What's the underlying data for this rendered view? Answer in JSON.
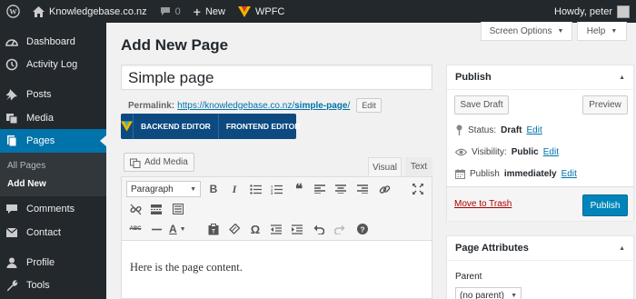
{
  "adminbar": {
    "site_name": "Knowledgebase.co.nz",
    "comments_count": "0",
    "new_label": "New",
    "plugin_label": "WPFC",
    "greeting": "Howdy, peter"
  },
  "sidebar": {
    "items": [
      {
        "label": "Dashboard",
        "icon": "dashboard-icon"
      },
      {
        "label": "Activity Log",
        "icon": "activity-log-icon"
      },
      {
        "label": "Posts",
        "icon": "pin-icon"
      },
      {
        "label": "Media",
        "icon": "media-icon"
      },
      {
        "label": "Pages",
        "icon": "pages-icon"
      },
      {
        "label": "Comments",
        "icon": "comments-icon"
      },
      {
        "label": "Contact",
        "icon": "envelope-icon"
      },
      {
        "label": "Profile",
        "icon": "user-icon"
      },
      {
        "label": "Tools",
        "icon": "wrench-icon"
      }
    ],
    "submenu": [
      {
        "label": "All Pages"
      },
      {
        "label": "Add New"
      }
    ]
  },
  "header": {
    "screen_options": "Screen Options",
    "help": "Help",
    "page_title": "Add New Page"
  },
  "editor": {
    "title_value": "Simple page",
    "permalink_label": "Permalink:",
    "permalink_base": "https://knowledgebase.co.nz/",
    "permalink_slug": "simple-page",
    "permalink_trailing": "/",
    "edit_label": "Edit",
    "builder": {
      "backend": "BACKEND EDITOR",
      "frontend": "FRONTEND EDITOR"
    },
    "add_media": "Add Media",
    "tab_visual": "Visual",
    "tab_text": "Text",
    "format_value": "Paragraph",
    "content": "Here is the page content."
  },
  "publish": {
    "title": "Publish",
    "save_draft": "Save Draft",
    "preview": "Preview",
    "status_label": "Status:",
    "status_value": "Draft",
    "visibility_label": "Visibility:",
    "visibility_value": "Public",
    "publish_label": "Publish",
    "publish_value": "immediately",
    "edit": "Edit",
    "trash": "Move to Trash",
    "publish_button": "Publish"
  },
  "attributes": {
    "title": "Page Attributes",
    "parent_label": "Parent",
    "parent_value": "(no parent)"
  },
  "colors": {
    "adminbar_bg": "#23282d",
    "accent": "#0073aa",
    "primary_button": "#0085ba",
    "trash": "#a00"
  }
}
